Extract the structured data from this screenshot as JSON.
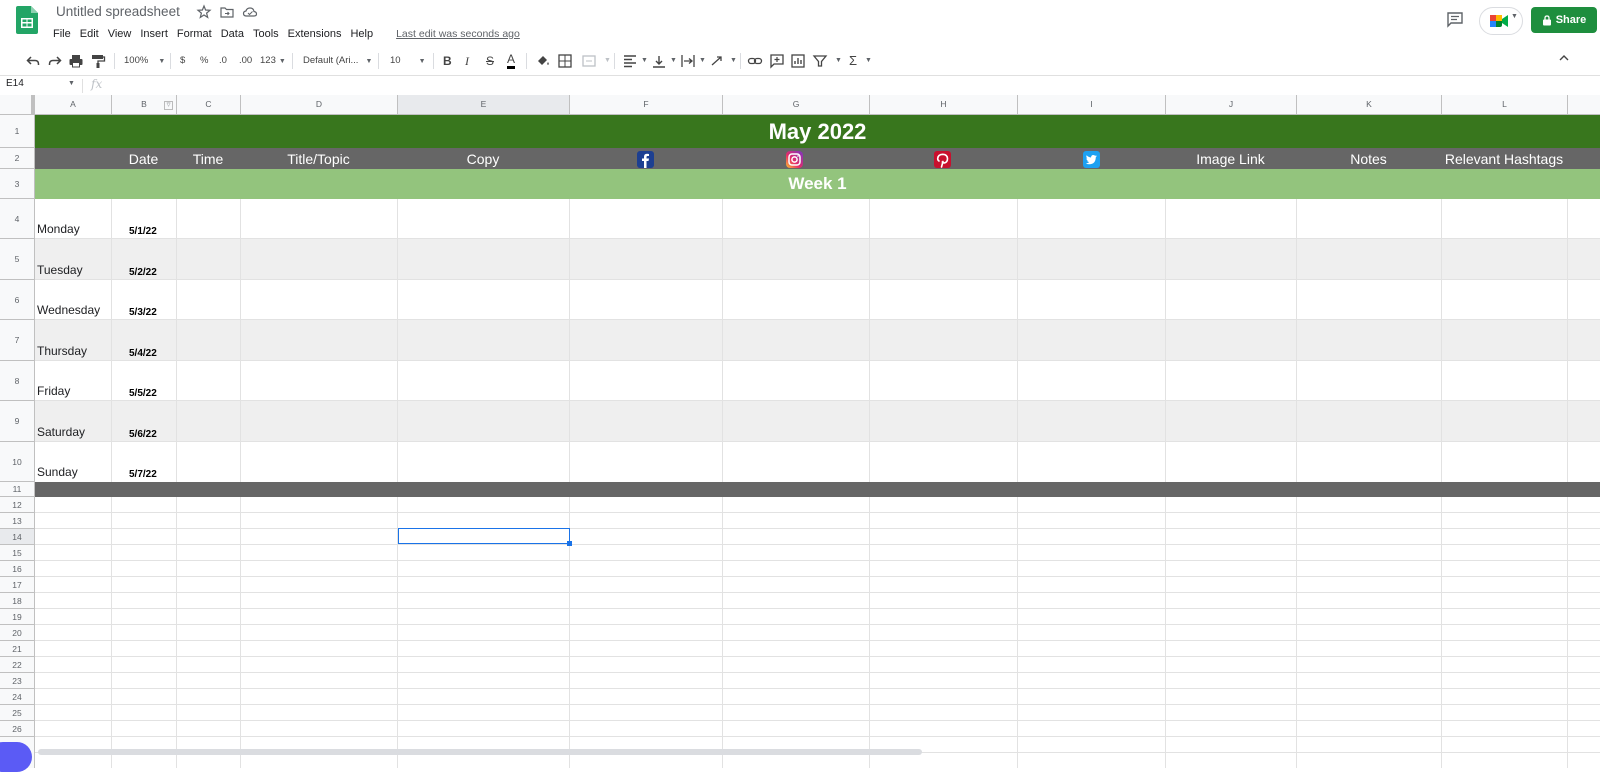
{
  "app": {
    "doc_title": "Untitled spreadsheet",
    "menu": [
      "File",
      "Edit",
      "View",
      "Insert",
      "Format",
      "Data",
      "Tools",
      "Extensions",
      "Help"
    ],
    "last_edit": "Last edit was seconds ago",
    "share_label": "Share"
  },
  "toolbar": {
    "zoom": "100%",
    "currency": "$",
    "percent": "%",
    "decrease_decimal": ".0",
    "increase_decimal": ".00",
    "more_formats": "123",
    "font": "Default (Ari...",
    "font_size": "10",
    "bold": "B",
    "italic": "I",
    "strikethrough": "S",
    "text_color": "A",
    "sum": "Σ"
  },
  "formula_bar": {
    "name_box": "E14",
    "fx": "fx",
    "value": ""
  },
  "grid": {
    "columns": [
      "A",
      "B",
      "C",
      "D",
      "E",
      "F",
      "G",
      "H",
      "I",
      "J",
      "K",
      "L"
    ],
    "selected_column": "E",
    "rows": [
      "1",
      "2",
      "3",
      "4",
      "5",
      "6",
      "7",
      "8",
      "9",
      "10",
      "11",
      "12",
      "13",
      "14",
      "15",
      "16",
      "17",
      "18",
      "19",
      "20",
      "21",
      "22",
      "23",
      "24",
      "25",
      "26"
    ],
    "selected_row": "14",
    "selected_cell": "E14"
  },
  "sheet": {
    "title": "May 2022",
    "headers": {
      "date": "Date",
      "time": "Time",
      "topic": "Title/Topic",
      "copy": "Copy",
      "facebook": "facebook-icon",
      "instagram": "instagram-icon",
      "pinterest": "pinterest-icon",
      "twitter": "twitter-icon",
      "image_link": "Image Link",
      "notes": "Notes",
      "hashtags": "Relevant Hashtags"
    },
    "week_label": "Week 1",
    "days": [
      {
        "day": "Monday",
        "date": "5/1/22"
      },
      {
        "day": "Tuesday",
        "date": "5/2/22"
      },
      {
        "day": "Wednesday",
        "date": "5/3/22"
      },
      {
        "day": "Thursday",
        "date": "5/4/22"
      },
      {
        "day": "Friday",
        "date": "5/5/22"
      },
      {
        "day": "Saturday",
        "date": "5/6/22"
      },
      {
        "day": "Sunday",
        "date": "5/7/22"
      }
    ]
  },
  "colors": {
    "title_bg": "#38761d",
    "header_bg": "#666666",
    "week_bg": "#93c47d",
    "alt_row": "#efefef",
    "share_bg": "#1e8e3e",
    "selection": "#1a73e8"
  }
}
